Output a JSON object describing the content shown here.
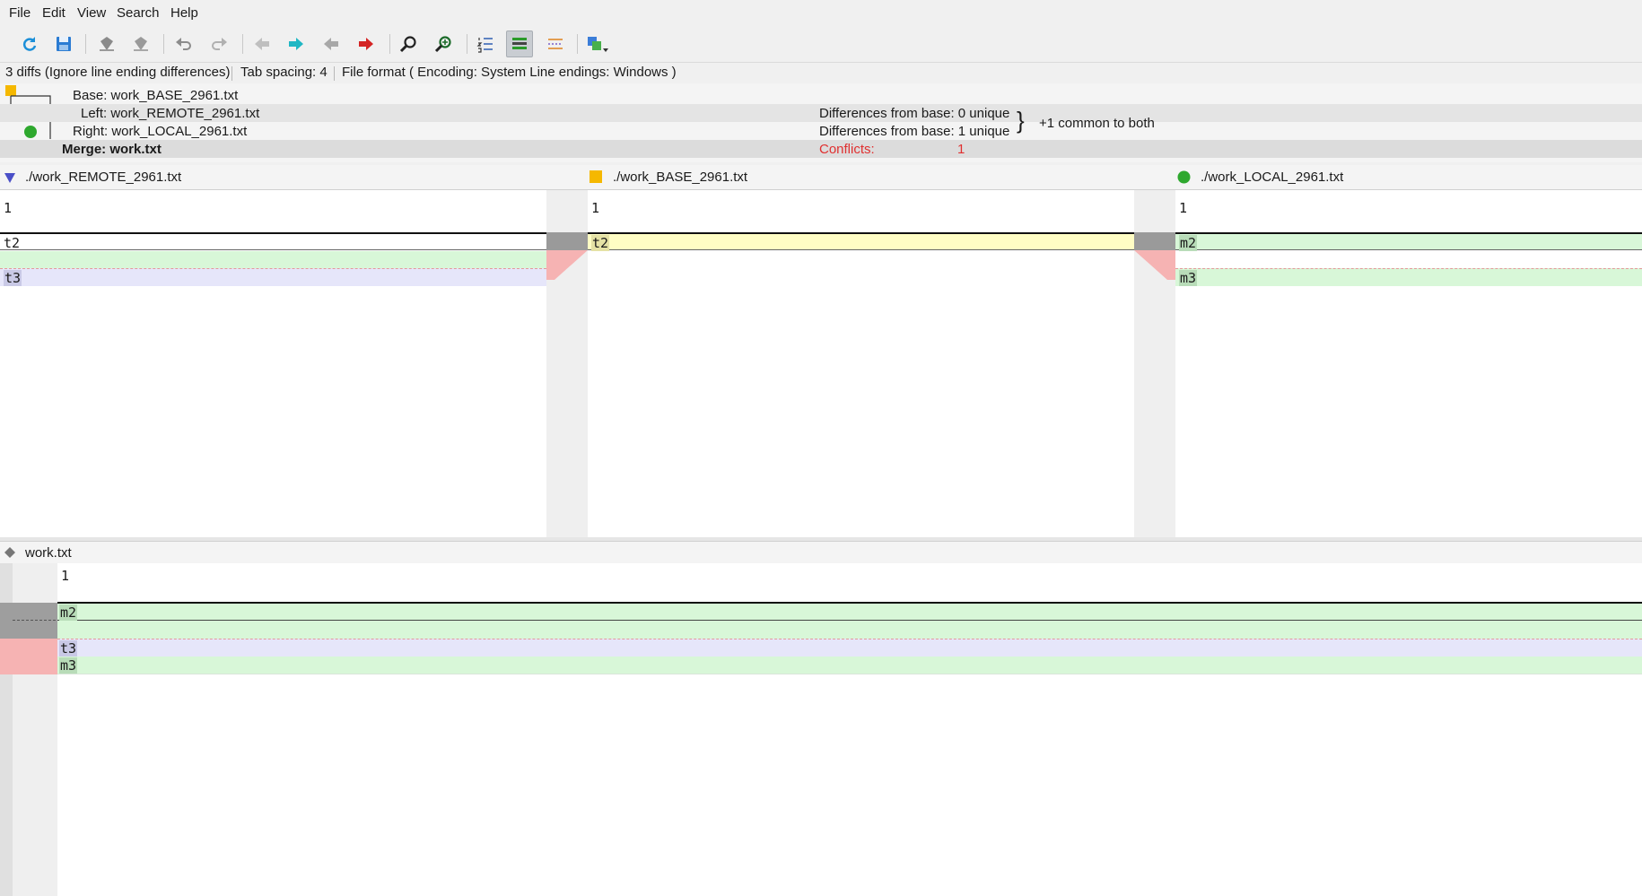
{
  "menu": {
    "items": [
      {
        "label": "File"
      },
      {
        "label": "Edit"
      },
      {
        "label": "View"
      },
      {
        "label": "Search"
      },
      {
        "label": "Help"
      }
    ]
  },
  "toolbar": {
    "buttons": [
      {
        "name": "reload",
        "icon": "refresh-icon"
      },
      {
        "name": "save",
        "icon": "save-icon"
      },
      {
        "name": "mark-left",
        "icon": "marker-icon"
      },
      {
        "name": "mark-right",
        "icon": "marker-icon"
      },
      {
        "name": "undo",
        "icon": "undo-icon"
      },
      {
        "name": "redo",
        "icon": "redo-icon"
      },
      {
        "name": "prev-diff",
        "icon": "arrow-left-icon"
      },
      {
        "name": "next-diff",
        "icon": "arrow-right-icon"
      },
      {
        "name": "prev-conflict",
        "icon": "arrow-left-icon"
      },
      {
        "name": "next-conflict",
        "icon": "arrow-right-icon"
      },
      {
        "name": "find",
        "icon": "magnifier-icon"
      },
      {
        "name": "find-next",
        "icon": "magnifier-icon"
      },
      {
        "name": "line-numbers",
        "icon": "line-numbers-icon"
      },
      {
        "name": "show-diff-lines",
        "icon": "lines-icon",
        "active": true
      },
      {
        "name": "show-whitespace",
        "icon": "whitespace-icon"
      },
      {
        "name": "windows",
        "icon": "windows-icon"
      }
    ]
  },
  "status": {
    "diffs": "3 diffs (Ignore line ending differences)",
    "tab": "Tab spacing: 4",
    "format": "File format ( Encoding: System  Line endings: Windows )"
  },
  "info": {
    "base": "Base: work_BASE_2961.txt",
    "left": "Left: work_REMOTE_2961.txt",
    "right": "Right: work_LOCAL_2961.txt",
    "merge": "Merge: work.txt",
    "left_diff": "Differences from base: 0 unique",
    "right_diff": "Differences from base: 1 unique",
    "common": "+1 common to both",
    "conflicts_label": "Conflicts:",
    "conflicts_value": "1"
  },
  "panes": {
    "left": {
      "title": "./work_REMOTE_2961.txt",
      "lines": [
        "1",
        "t2",
        "",
        "t3"
      ]
    },
    "base": {
      "title": "./work_BASE_2961.txt",
      "lines": [
        "1",
        "t2"
      ]
    },
    "right": {
      "title": "./work_LOCAL_2961.txt",
      "lines": [
        "1",
        "m2",
        "",
        "m3"
      ]
    }
  },
  "output": {
    "title": "work.txt",
    "lines": [
      "1",
      "m2",
      "",
      "t3",
      "m3"
    ]
  },
  "colors": {
    "remote": "#4a4fc7",
    "base": "#f5b800",
    "local": "#2ea82e",
    "added_green": "#d8f7d8",
    "conflict_red": "#f6b3b3",
    "base_yellow": "#fffdc4",
    "remote_purple": "#e6e6fa"
  }
}
